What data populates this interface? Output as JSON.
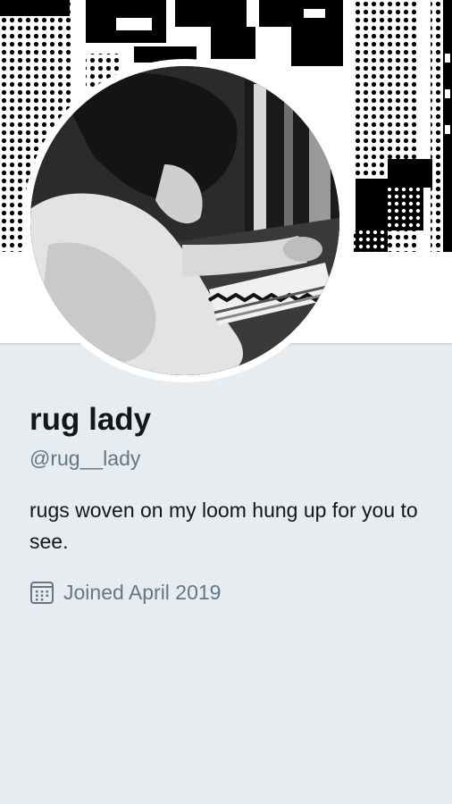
{
  "header": {
    "banner_icon": "woven-rug-pattern-banner",
    "avatar_icon": "person-weaving-on-loom-photo"
  },
  "profile": {
    "display_name": "rug lady",
    "handle": "@rug__lady",
    "bio": "rugs woven on my loom hung up for you to see.",
    "joined_icon": "calendar-icon",
    "joined_text": "Joined April 2019"
  },
  "colors": {
    "background": "#e6ecf0",
    "text_primary": "#14171a",
    "text_secondary": "#657786"
  }
}
